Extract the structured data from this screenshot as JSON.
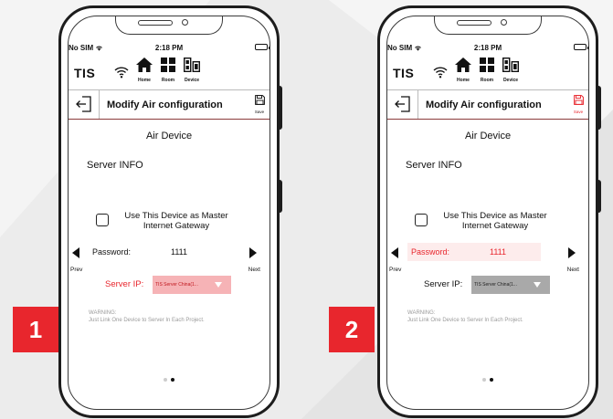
{
  "badges": [
    "1",
    "2"
  ],
  "colors": {
    "accent": "#e8262d",
    "highlight_bg": "#fdecec",
    "select_highlight": "#f6b3b6",
    "select_grey": "#a9a9a9",
    "save_red": "#e8262d"
  },
  "screens": [
    {
      "status": {
        "carrier": "No SIM",
        "time": "2:18 PM"
      },
      "appbar": {
        "logo": "TIS",
        "nav": [
          "Home",
          "Room",
          "Device"
        ]
      },
      "titlebar": {
        "title": "Modify Air configuration",
        "save_label": "Save"
      },
      "device_title": "Air Device",
      "server_info": "Server INFO",
      "gateway_label": "Use This Device as Master Internet Gateway",
      "prev_label": "Prev",
      "next_label": "Next",
      "password": {
        "label": "Password:",
        "value": "1111",
        "highlighted": false
      },
      "server_ip": {
        "label": "Server IP:",
        "selected": "TIS Server China(1...",
        "highlighted": true
      },
      "warning": [
        "WARNING:",
        "Just Link One Device to Server In Each Project."
      ]
    },
    {
      "status": {
        "carrier": "No SIM",
        "time": "2:18 PM"
      },
      "appbar": {
        "logo": "TIS",
        "nav": [
          "Home",
          "Room",
          "Device"
        ]
      },
      "titlebar": {
        "title": "Modify Air configuration",
        "save_label": "Save"
      },
      "device_title": "Air Device",
      "server_info": "Server INFO",
      "gateway_label": "Use This Device as Master Internet Gateway",
      "prev_label": "Prev",
      "next_label": "Next",
      "password": {
        "label": "Password:",
        "value": "1111",
        "highlighted": true
      },
      "server_ip": {
        "label": "Server IP:",
        "selected": "TIS Server China(1...",
        "highlighted": false
      },
      "warning": [
        "WARNING:",
        "Just Link One Device to Server In Each Project."
      ]
    }
  ]
}
